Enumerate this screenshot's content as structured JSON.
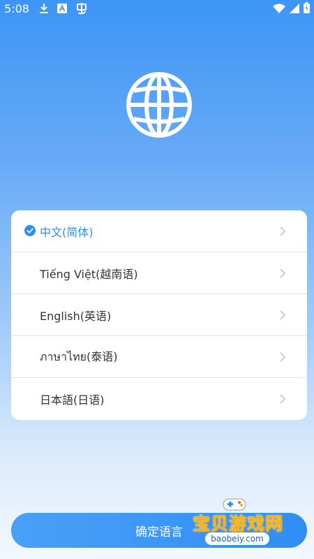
{
  "status_bar": {
    "time": "5:08",
    "icons": [
      "download-icon",
      "a-badge-icon",
      "bug-icon",
      "wifi-icon",
      "signal-icon",
      "battery-icon"
    ]
  },
  "globe_icon": "globe-icon",
  "languages": [
    {
      "label": "中文(简体)",
      "selected": true
    },
    {
      "label": "Tiếng Việt(越南语)",
      "selected": false
    },
    {
      "label": "English(英语)",
      "selected": false
    },
    {
      "label": "ภาษาไทย(泰语)",
      "selected": false
    },
    {
      "label": "日本語(日语)",
      "selected": false
    }
  ],
  "confirm_label": "确定语言",
  "watermark": {
    "title": "宝贝游戏网",
    "url": "baobeiy.com"
  },
  "colors": {
    "accent": "#2f8ef5",
    "gradient_top": "#3d95f6",
    "gradient_bottom": "#f3f8ff"
  }
}
